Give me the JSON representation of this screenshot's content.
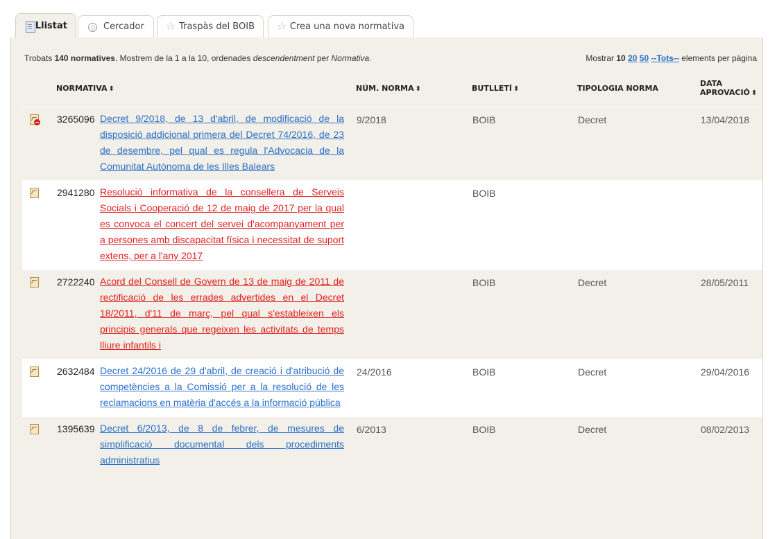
{
  "tabs": [
    {
      "label": "Llistat",
      "icon": "document-icon",
      "active": true
    },
    {
      "label": "Cercador",
      "icon": "search-icon",
      "active": false
    },
    {
      "label": "Traspàs del BOIB",
      "icon": "star-icon",
      "active": false
    },
    {
      "label": "Crea una nova normativa",
      "icon": "star-icon",
      "active": false
    }
  ],
  "summary": {
    "prefix": "Trobats ",
    "count": "140 normatives",
    "middle": ". Mostrem de la 1 a la 10, ordenades ",
    "order": "descendentment",
    "by": " per ",
    "field": "Normativa",
    "end": "."
  },
  "perpage": {
    "prefix": "Mostrar ",
    "current": "10",
    "opt20": "20",
    "opt50": "50",
    "all": "--Tots--",
    "suffix": " elements per pàgina"
  },
  "columns": {
    "normativa": "NORMATIVA",
    "num": "NÚM. NORMA",
    "butlleti": "BUTLLETÍ",
    "tipologia": "TIPOLOGIA NORMA",
    "data": "DATA APROVACIÓ",
    "sort_glyph": "⬍"
  },
  "rows": [
    {
      "id": "3265096",
      "title": "Decret 9/2018, de 13 d'abril, de modificació de la disposició addicional primera del Decret 74/2016, de 23 de desembre, pel qual es regula l'Advocacia de la Comunitat Autònoma de les Illes Balears",
      "link_color": "blue",
      "icon": "document-blocked-icon",
      "num": "9/2018",
      "butlleti": "BOIB",
      "tipologia": "Decret",
      "data": "13/04/2018"
    },
    {
      "id": "2941280",
      "title": "Resolució informativa de la consellera de Serveis Socials i Cooperació de 12 de maig de 2017 per la qual es convoca el concert del servei d'acompanyament per a persones amb discapacitat física i necessitat de suport extens, per a l'any 2017",
      "link_color": "red",
      "icon": "document-icon",
      "num": "",
      "butlleti": "BOIB",
      "tipologia": "",
      "data": ""
    },
    {
      "id": "2722240",
      "title": "Acord del Consell de Govern de 13 de maig de 2011 de rectificació de les errades advertides en el Decret 18/2011, d'11 de març, pel qual s'estableixen els principis generals que regeixen les activitats de temps lliure infantils i",
      "link_color": "red",
      "icon": "document-icon",
      "num": "",
      "butlleti": "BOIB",
      "tipologia": "Decret",
      "data": "28/05/2011"
    },
    {
      "id": "2632484",
      "title": "Decret 24/2016 de 29 d'abril, de creació i d'atribució de competències a la Comissió per a la resolució de les reclamacions en matèria d'accés a la informació pública",
      "link_color": "blue",
      "icon": "document-icon",
      "num": "24/2016",
      "butlleti": "BOIB",
      "tipologia": "Decret",
      "data": "29/04/2016"
    },
    {
      "id": "1395639",
      "title": "Decret 6/2013, de 8 de febrer, de mesures de simplificació documental dels procediments administratius",
      "link_color": "blue",
      "icon": "document-icon",
      "num": "6/2013",
      "butlleti": "BOIB",
      "tipologia": "Decret",
      "data": "08/02/2013"
    }
  ],
  "colors": {
    "link_blue": "#2a6fc9",
    "link_red": "#e02020",
    "panel_bg": "#f2f0e8",
    "row_alt": "#ffffff"
  }
}
